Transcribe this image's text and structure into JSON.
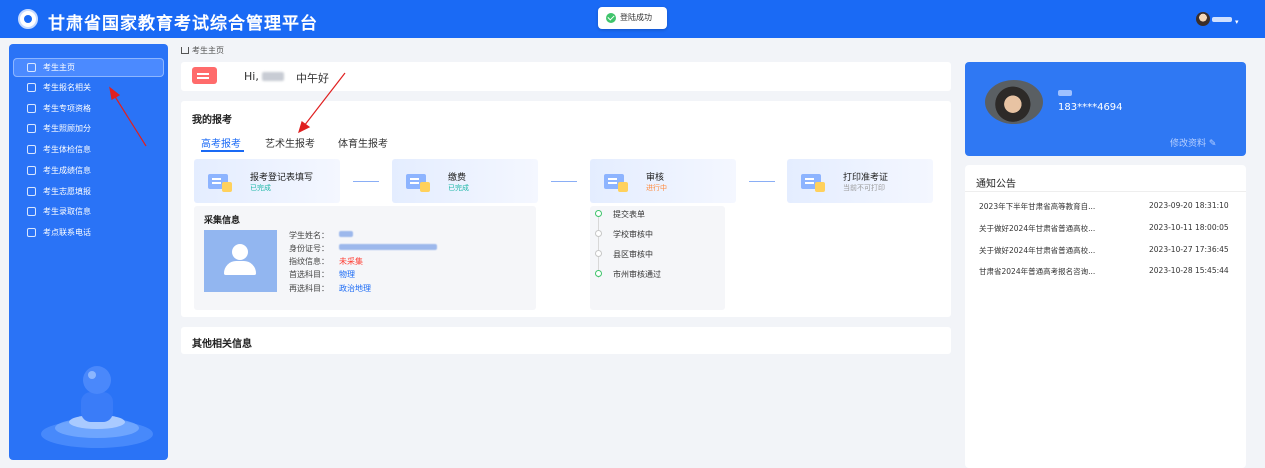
{
  "header": {
    "title": "甘肃省国家教育考试综合管理平台",
    "toast": "登陆成功"
  },
  "sidebar": {
    "items": [
      {
        "label": "考生主页",
        "icon": "user-icon"
      },
      {
        "label": "考生报名相关",
        "icon": "form-icon"
      },
      {
        "label": "考生专项资格",
        "icon": "check-icon"
      },
      {
        "label": "考生照顾加分",
        "icon": "card-icon"
      },
      {
        "label": "考生体检信息",
        "icon": "eye-icon"
      },
      {
        "label": "考生成绩信息",
        "icon": "score-icon"
      },
      {
        "label": "考生志愿填报",
        "icon": "mail-icon"
      },
      {
        "label": "考生录取信息",
        "icon": "doc-icon"
      },
      {
        "label": "考点联系电话",
        "icon": "phone-icon"
      }
    ]
  },
  "breadcrumb": "考生主页",
  "greeting": {
    "hi": "Hi,",
    "time_text": "中午好"
  },
  "registration": {
    "title": "我的报考",
    "tabs": [
      "高考报考",
      "艺术生报考",
      "体育生报考"
    ],
    "steps": [
      {
        "name": "报考登记表填写",
        "status": "已完成",
        "status_color": "#1fb8a8"
      },
      {
        "name": "缴费",
        "status": "已完成",
        "status_color": "#1fb8a8"
      },
      {
        "name": "审核",
        "status": "进行中",
        "status_color": "#ff8a3d"
      },
      {
        "name": "打印准考证",
        "status": "当前不可打印",
        "status_color": "#999999"
      }
    ],
    "collect": {
      "title": "采集信息",
      "fields": [
        {
          "label": "学生姓名：",
          "value": ""
        },
        {
          "label": "身份证号：",
          "value": ""
        },
        {
          "label": "指纹信息：",
          "value": "未采集"
        },
        {
          "label": "首选科目：",
          "value": "物理"
        },
        {
          "label": "再选科目：",
          "value": "政治地理"
        }
      ]
    },
    "audit": [
      {
        "label": "提交表单",
        "done": true
      },
      {
        "label": "学校审核中",
        "done": false
      },
      {
        "label": "县区审核中",
        "done": false
      },
      {
        "label": "市州审核通过",
        "done": true
      }
    ]
  },
  "other": {
    "title": "其他相关信息"
  },
  "profile": {
    "phone": "183****4694",
    "edit_label": "修改资料 ✎"
  },
  "notices": {
    "title": "通知公告",
    "items": [
      {
        "text": "2023年下半年甘肃省高等教育自...",
        "date": "2023-09-20 18:31:10"
      },
      {
        "text": "关于做好2024年甘肃省普通高校...",
        "date": "2023-10-11 18:00:05"
      },
      {
        "text": "关于做好2024年甘肃省普通高校...",
        "date": "2023-10-27 17:36:45"
      },
      {
        "text": "甘肃省2024年普通高考报名咨询...",
        "date": "2023-10-28 15:45:44"
      }
    ]
  },
  "colors": {
    "primary": "#1a6af5",
    "sidebar": "#2a73f6",
    "danger": "#ff3b30"
  }
}
